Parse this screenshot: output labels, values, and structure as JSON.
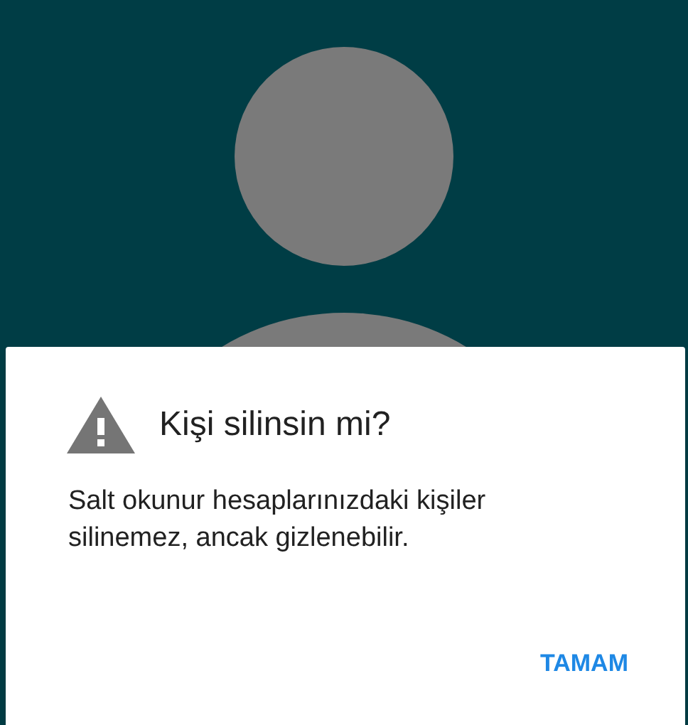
{
  "dialog": {
    "title": "Kişi silinsin mi?",
    "message": "Salt okunur hesaplarınızdaki kişiler silinemez, ancak gizlenebilir.",
    "buttons": [
      "TAMAM"
    ]
  }
}
